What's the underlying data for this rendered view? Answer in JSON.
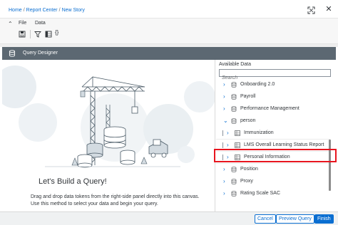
{
  "breadcrumb": {
    "items": [
      "Home",
      "Report Center",
      "New Story"
    ],
    "separator": "/"
  },
  "window_controls": {
    "expand_icon": "expand-icon",
    "close_icon": "close-icon",
    "close_glyph": "✕"
  },
  "toolbar": {
    "collapse_glyph": "⌃",
    "menus": {
      "file": "File",
      "data": "Data"
    },
    "icons": [
      "save-icon",
      "filter-icon",
      "table-icon",
      "formula-icon"
    ],
    "formula_glyph": "{}"
  },
  "query_designer": {
    "title": "Query Designer",
    "icon": "database-icon"
  },
  "canvas": {
    "heading": "Let's Build a Query!",
    "description": "Drag and drop data tokens from the right-side panel directly into this canvas. Use this method to select your data and begin your query."
  },
  "available_data": {
    "title": "Available Data",
    "search_placeholder": "Search",
    "items": [
      {
        "label": "Onboarding 2.0",
        "level": 0,
        "expanded": false
      },
      {
        "label": "Payroll",
        "level": 0,
        "expanded": false
      },
      {
        "label": "Performance Management",
        "level": 0,
        "expanded": false
      },
      {
        "label": "person",
        "level": 0,
        "expanded": true
      },
      {
        "label": "Immunization",
        "level": 1,
        "expanded": false
      },
      {
        "label": "LMS Overall Learning Status Report",
        "level": 1,
        "expanded": false,
        "highlighted": true
      },
      {
        "label": "Personal Information",
        "level": 1,
        "expanded": false
      },
      {
        "label": "Position",
        "level": 0,
        "expanded": false
      },
      {
        "label": "Proxy",
        "level": 0,
        "expanded": false
      },
      {
        "label": "Rating Scale SAC",
        "level": 0,
        "expanded": false
      }
    ]
  },
  "footer": {
    "cancel": "Cancel",
    "preview": "Preview Query",
    "finish": "Finish"
  },
  "colors": {
    "accent": "#0a6ed1",
    "header_band": "#5c6872",
    "highlight": "#e8151f"
  }
}
